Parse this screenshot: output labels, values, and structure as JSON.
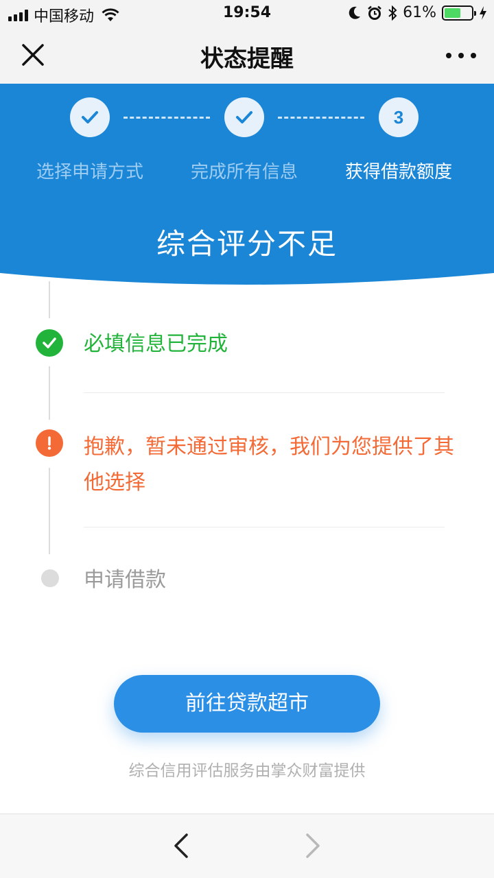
{
  "status_bar": {
    "carrier": "中国移动",
    "time": "19:54",
    "battery_percent_label": "61%",
    "battery_level": 0.61,
    "icons": [
      "signal-icon",
      "wifi-icon",
      "moon-icon",
      "alarm-icon",
      "bluetooth-icon",
      "battery-icon",
      "charging-icon"
    ]
  },
  "navbar": {
    "title": "状态提醒",
    "close_icon": "close-icon",
    "more_icon": "more-icon"
  },
  "steps": [
    {
      "label": "选择申请方式",
      "state": "done",
      "icon": "check-icon"
    },
    {
      "label": "完成所有信息",
      "state": "done",
      "icon": "check-icon"
    },
    {
      "label": "获得借款额度",
      "state": "active",
      "number": "3"
    }
  ],
  "header": {
    "hero_text": "综合评分不足",
    "color": "#1b86d6"
  },
  "timeline": [
    {
      "text": "必填信息已完成",
      "status": "success",
      "color": "#22b33a",
      "icon": "check-circle-icon"
    },
    {
      "text": "抱歉，暂未通过审核，我们为您提供了其他选择",
      "status": "warning",
      "color": "#f36a36",
      "icon": "exclamation-circle-icon"
    },
    {
      "text": "申请借款",
      "status": "pending",
      "color": "#9a9a9a",
      "icon": "gray-dot-icon"
    }
  ],
  "cta": {
    "label": "前往贷款超市",
    "color": "#2b8fe6"
  },
  "footnote": "综合信用评估服务由掌众财富提供",
  "bottom_bar": {
    "back_icon": "chevron-left-icon",
    "forward_icon": "chevron-right-icon"
  }
}
